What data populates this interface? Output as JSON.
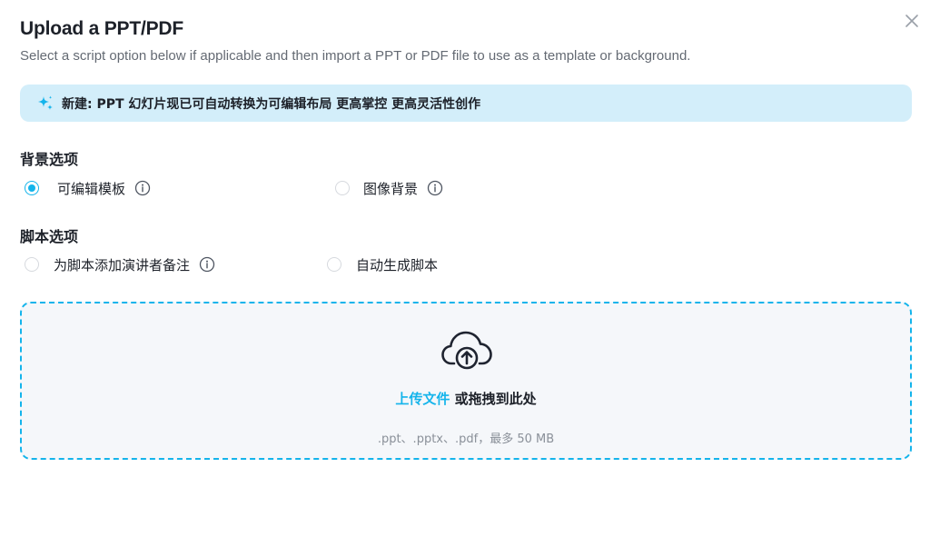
{
  "dialog": {
    "title": "Upload a PPT/PDF",
    "subtitle": "Select a script option below if applicable and then import a PPT or PDF file to use as a template or background.",
    "close_icon": "close-icon"
  },
  "banner": {
    "icon": "sparkle-icon",
    "text": "新建: PPT 幻灯片现已可自动转换为可编辑布局 更高掌控 更高灵活性创作",
    "background_color": "#d3eefa"
  },
  "background_options": {
    "title": "背景选项",
    "options": [
      {
        "label": "可编辑模板",
        "selected": true,
        "has_info": true
      },
      {
        "label": "图像背景",
        "selected": false,
        "has_info": true
      }
    ]
  },
  "script_options": {
    "title": "脚本选项",
    "options": [
      {
        "label": "为脚本添加演讲者备注",
        "selected": false,
        "has_info": true
      },
      {
        "label": "自动生成脚本",
        "selected": false,
        "has_info": false
      }
    ]
  },
  "dropzone": {
    "icon": "cloud-upload-icon",
    "upload_link": "上传文件",
    "drag_text": " 或拖拽到此处",
    "hint": ".ppt、.pptx、.pdf，最多 50 MB"
  },
  "colors": {
    "accent": "#14b4eb",
    "title": "#1d2129",
    "muted": "#646a73",
    "dropzone_bg": "#f5f7fa"
  }
}
